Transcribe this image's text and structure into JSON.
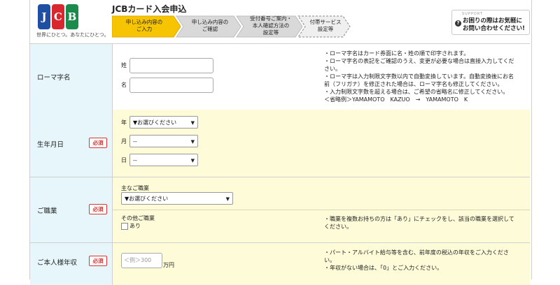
{
  "header": {
    "title": "JCBカード入会申込",
    "logo_text": "JCB",
    "tagline": "世界にひとつ。あなたにひとつ。",
    "steps": [
      {
        "line1": "申し込み内容の",
        "line2": "ご入力",
        "line3": ""
      },
      {
        "line1": "申し込み内容の",
        "line2": "ご確認",
        "line3": ""
      },
      {
        "line1": "受付番号ご案内・",
        "line2": "本人確認方法の",
        "line3": "設定等"
      },
      {
        "line1": "付帯サービス",
        "line2": "設定等",
        "line3": ""
      }
    ],
    "support_small": "SUPPORT",
    "support_line1": "お困りの際はお気軽に",
    "support_line2": "お問い合わせください!"
  },
  "colors": {
    "active_step": "#f6c400",
    "inactive_step": "#d9d9d9",
    "label_bg": "#e6f6fb",
    "form_bg": "#fdfbd8",
    "required": "#d33333"
  },
  "required_label": "必須",
  "roma": {
    "label": "ローマ字名",
    "sei_label": "姓",
    "mei_label": "名",
    "notes": [
      "・ローマ字名はカード券面に名・姓の順で印字されます。",
      "・ローマ字名の表記をご確認のうえ、変更が必要な場合は直接入力してくだ",
      "さい。",
      "・ローマ字は入力制限文字数以内で自動変換しています。自動変換後にお名",
      "前（フリガナ）を修正された場合は、ローマ字名も修正してください。",
      "・入力制限文字数を超える場合は、ご希望の省略名に修正してください。",
      "＜省略例＞YAMAMOTO　KAZUO　→　YAMAMOTO　K"
    ]
  },
  "birth": {
    "label": "生年月日",
    "year_label": "年",
    "year_value": "▼お選びください",
    "month_label": "月",
    "month_value": "--",
    "day_label": "日",
    "day_value": "--"
  },
  "job": {
    "label": "ご職業",
    "main_label": "主なご職業",
    "main_value": "▼お選びください",
    "other_label": "その他ご職業",
    "other_option": "あり",
    "notes": [
      "・職業を複数お持ちの方は「あり」にチェックをし、該当の職業を選択して",
      "ください。"
    ]
  },
  "income": {
    "label": "ご本人様年収",
    "placeholder": "＜例＞300",
    "unit": "万円",
    "notes": [
      "・パート・アルバイト給与等を含む、前年度の税込の年収をご入力くださ",
      "い。",
      "・年収がない場合は、「0」とご入力ください。"
    ]
  }
}
